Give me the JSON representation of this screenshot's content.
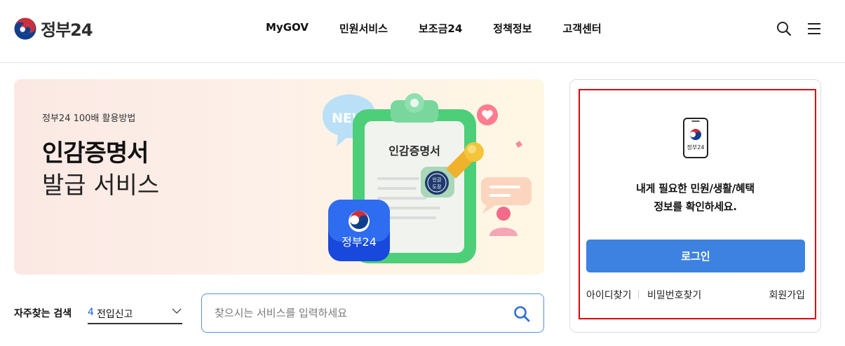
{
  "header": {
    "logo_text": "정부24",
    "nav": [
      "MyGOV",
      "민원서비스",
      "보조금24",
      "정책정보",
      "고객센터"
    ],
    "search_icon": "search-icon",
    "menu_icon": "hamburger-menu-icon"
  },
  "banner": {
    "subtitle": "정부24 100배 활용방법",
    "title": "인감증명서",
    "title2": "발급 서비스",
    "art": {
      "new_bubble": "NEW",
      "clipboard_title": "인감증명서",
      "stamp_text_1": "인감",
      "stamp_text_2": "도장",
      "app_icon_text": "정부24"
    }
  },
  "frequent_search": {
    "label": "자주찾는 검색",
    "rank": "4",
    "term": "전입신고"
  },
  "search": {
    "placeholder": "찾으시는 서비스를 입력하세요"
  },
  "login_panel": {
    "phone_label": "정부24",
    "message_line1": "내게 필요한 민원/생활/혜택",
    "message_line2": "정보를 확인하세요.",
    "login_button": "로그인",
    "find_id": "아이디찾기",
    "find_password": "비밀번호찾기",
    "join": "회원가입"
  },
  "colors": {
    "accent": "#3d82e0",
    "highlight_border": "#e0000b",
    "emblem_red": "#cd2e3a",
    "emblem_blue": "#0f3f8c"
  }
}
